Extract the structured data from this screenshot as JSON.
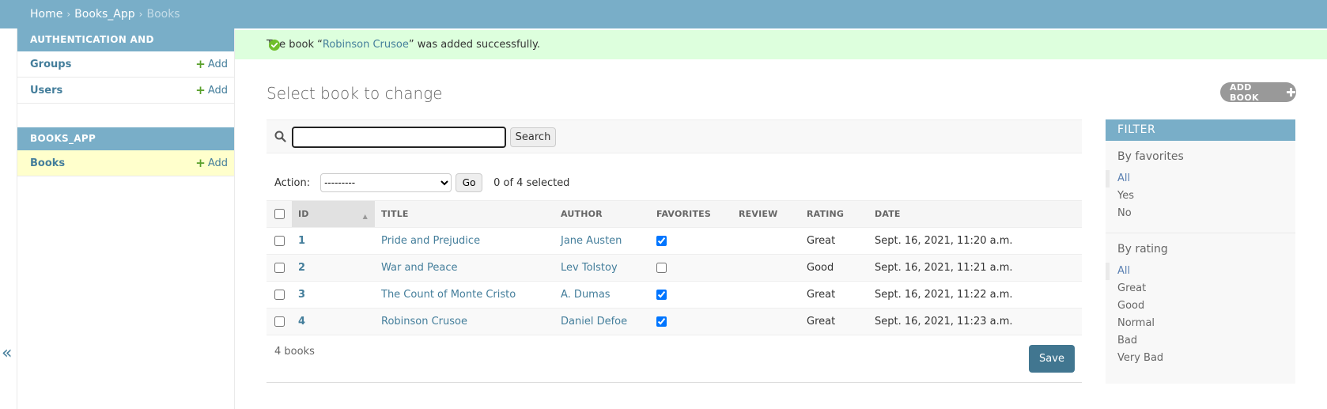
{
  "breadcrumbs": {
    "home": "Home",
    "app": "Books_App",
    "current": "Books",
    "separator": "›"
  },
  "sidebar": {
    "modules": [
      {
        "caption": "AUTHENTICATION AND AUTHORIZATION",
        "models": [
          {
            "name": "Groups",
            "add": "Add"
          },
          {
            "name": "Users",
            "add": "Add"
          }
        ]
      },
      {
        "caption": "BOOKS_APP",
        "models": [
          {
            "name": "Books",
            "add": "Add"
          }
        ]
      }
    ],
    "collapse_toggle": "«"
  },
  "message": {
    "prefix": "The book “",
    "book": "Robinson Crusoe",
    "suffix": "” was added successfully.",
    "color": "#ddffdd"
  },
  "content": {
    "title": "Select book to change",
    "add_button": "ADD BOOK"
  },
  "search": {
    "value": "",
    "button": "Search"
  },
  "actions": {
    "label": "Action:",
    "selected_option": "---------",
    "go": "Go",
    "counter": "0 of 4 selected"
  },
  "table": {
    "headers": [
      "ID",
      "TITLE",
      "AUTHOR",
      "FAVORITES",
      "REVIEW",
      "RATING",
      "DATE"
    ],
    "rows": [
      {
        "id": "1",
        "title": "Pride and Prejudice",
        "author": "Jane Austen",
        "favorite": true,
        "review": "",
        "rating": "Great",
        "date": "Sept. 16, 2021, 11:20 a.m."
      },
      {
        "id": "2",
        "title": "War and Peace",
        "author": "Lev Tolstoy",
        "favorite": false,
        "review": "",
        "rating": "Good",
        "date": "Sept. 16, 2021, 11:21 a.m."
      },
      {
        "id": "3",
        "title": "The Count of Monte Cristo",
        "author": "A. Dumas",
        "favorite": true,
        "review": "",
        "rating": "Great",
        "date": "Sept. 16, 2021, 11:22 a.m."
      },
      {
        "id": "4",
        "title": "Robinson Crusoe",
        "author": "Daniel Defoe",
        "favorite": true,
        "review": "",
        "rating": "Great",
        "date": "Sept. 16, 2021, 11:23 a.m."
      }
    ]
  },
  "paginator": {
    "count": "4 books",
    "save": "Save"
  },
  "filter": {
    "title": "FILTER",
    "groups": [
      {
        "title": "By favorites",
        "options": [
          "All",
          "Yes",
          "No"
        ],
        "selected": "All"
      },
      {
        "title": "By rating",
        "options": [
          "All",
          "Great",
          "Good",
          "Normal",
          "Bad",
          "Very Bad"
        ],
        "selected": "All"
      }
    ]
  },
  "colors": {
    "header": "#79aec8",
    "link": "#447e9b",
    "save_button": "#417690",
    "success_bg": "#ddffdd"
  }
}
